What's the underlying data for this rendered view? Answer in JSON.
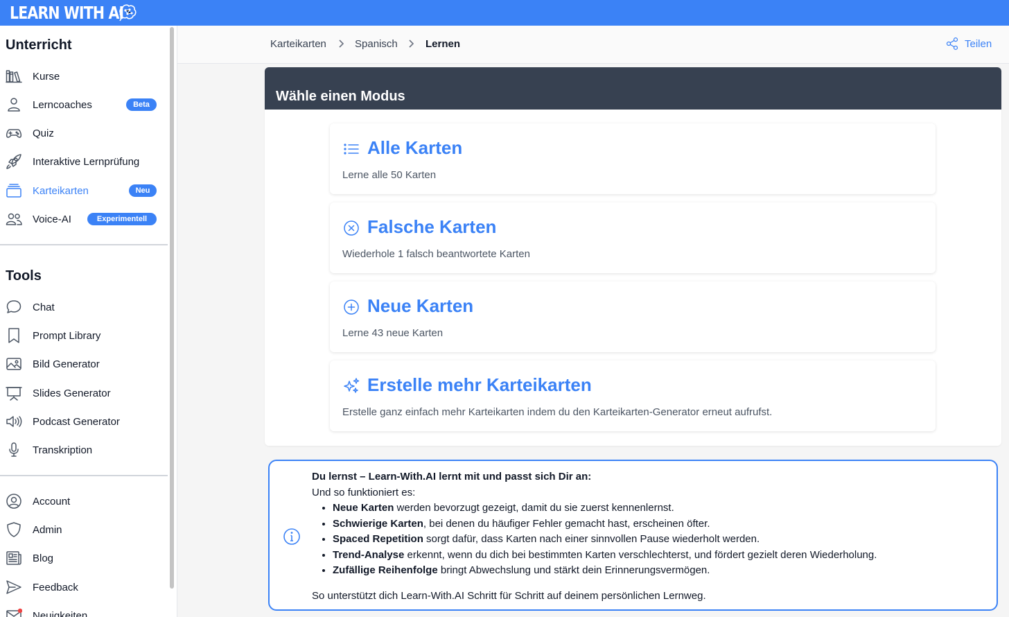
{
  "app": {
    "logo_text": "LEARN WITH AI"
  },
  "sidebar": {
    "section_unterricht": "Unterricht",
    "unterricht_items": [
      {
        "label": "Kurse",
        "icon": "books-icon"
      },
      {
        "label": "Lerncoaches",
        "icon": "user-icon",
        "badge": "Beta"
      },
      {
        "label": "Quiz",
        "icon": "gamepad-icon"
      },
      {
        "label": "Interaktive Lernprüfung",
        "icon": "rocket-icon"
      },
      {
        "label": "Karteikarten",
        "icon": "cards-icon",
        "badge": "Neu",
        "active": true
      },
      {
        "label": "Voice-AI",
        "icon": "users-icon",
        "badge": "Experimentell"
      }
    ],
    "section_tools": "Tools",
    "tools_items": [
      {
        "label": "Chat",
        "icon": "chat-bubble-icon"
      },
      {
        "label": "Prompt Library",
        "icon": "bookmark-icon"
      },
      {
        "label": "Bild Generator",
        "icon": "image-icon"
      },
      {
        "label": "Slides Generator",
        "icon": "presentation-icon"
      },
      {
        "label": "Podcast Generator",
        "icon": "speaker-icon"
      },
      {
        "label": "Transkription",
        "icon": "microphone-icon"
      }
    ],
    "account_items": [
      {
        "label": "Account",
        "icon": "account-icon"
      },
      {
        "label": "Admin",
        "icon": "shield-icon"
      },
      {
        "label": "Blog",
        "icon": "newspaper-icon"
      },
      {
        "label": "Feedback",
        "icon": "send-icon"
      },
      {
        "label": "Neuigkeiten",
        "icon": "mail-icon"
      }
    ]
  },
  "breadcrumb": {
    "items": [
      "Karteikarten",
      "Spanisch",
      "Lernen"
    ]
  },
  "share_label": "Teilen",
  "mode": {
    "heading": "Wähle einen Modus",
    "cards": [
      {
        "title": "Alle Karten",
        "description": "Lerne alle 50 Karten",
        "icon": "list-icon"
      },
      {
        "title": "Falsche Karten",
        "description": "Wiederhole 1 falsch beantwortete Karten",
        "icon": "x-circle-icon"
      },
      {
        "title": "Neue Karten",
        "description": "Lerne 43 neue Karten",
        "icon": "plus-circle-icon"
      },
      {
        "title": "Erstelle mehr Karteikarten",
        "description": "Erstelle ganz einfach mehr Karteikarten indem du den Karteikarten-Generator erneut aufrufst.",
        "icon": "sparkles-icon"
      }
    ]
  },
  "info": {
    "heading": "Du lernst – Learn-With.AI lernt mit und passt sich Dir an:",
    "intro": "Und so funktioniert es:",
    "points": [
      {
        "bold": "Neue Karten",
        "text": " werden bevorzugt gezeigt, damit du sie zuerst kennenlernst."
      },
      {
        "bold": "Schwierige Karten",
        "text": ", bei denen du häufiger Fehler gemacht hast, erscheinen öfter."
      },
      {
        "bold": "Spaced Repetition",
        "text": " sorgt dafür, dass Karten nach einer sinnvollen Pause wiederholt werden."
      },
      {
        "bold": "Trend-Analyse",
        "text": " erkennt, wenn du dich bei bestimmten Karten verschlechterst, und fördert gezielt deren Wiederholung."
      },
      {
        "bold": "Zufällige Reihenfolge",
        "text": " bringt Abwechslung und stärkt dein Erinnerungsvermögen."
      }
    ],
    "footer": "So unterstützt dich Learn-With.AI Schritt für Schritt auf deinem persönlichen Lernweg."
  },
  "colors": {
    "accent": "#3b82f6",
    "header_dark": "#374151"
  }
}
